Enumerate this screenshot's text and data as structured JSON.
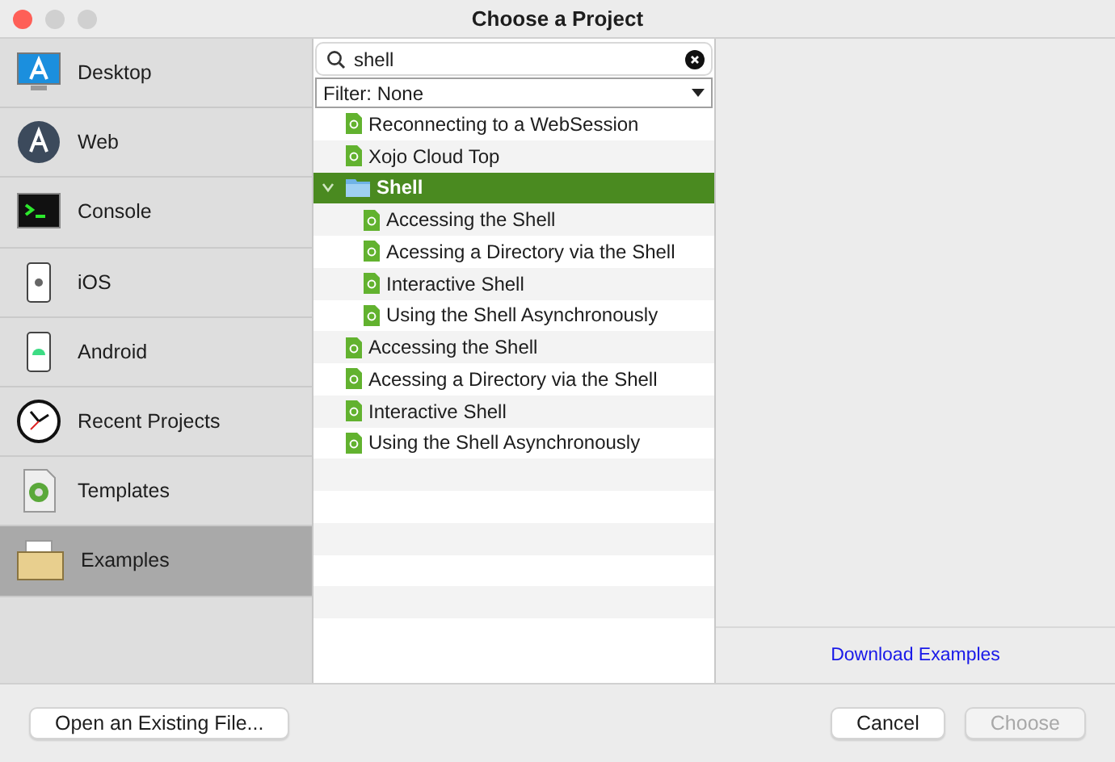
{
  "window": {
    "title": "Choose a Project"
  },
  "sidebar": {
    "items": [
      {
        "label": "Desktop",
        "selected": false
      },
      {
        "label": "Web",
        "selected": false
      },
      {
        "label": "Console",
        "selected": false
      },
      {
        "label": "iOS",
        "selected": false
      },
      {
        "label": "Android",
        "selected": false
      },
      {
        "label": "Recent Projects",
        "selected": false
      },
      {
        "label": "Templates",
        "selected": false
      },
      {
        "label": "Examples",
        "selected": true
      }
    ]
  },
  "search": {
    "value": "shell"
  },
  "filter": {
    "value": "Filter: None"
  },
  "tree": [
    {
      "label": "Reconnecting to a WebSession",
      "kind": "file",
      "selected": false
    },
    {
      "label": "Xojo Cloud Top",
      "kind": "file",
      "selected": false
    },
    {
      "label": "Shell",
      "kind": "folder",
      "selected": true,
      "expanded": true,
      "children": [
        {
          "label": "Accessing the Shell",
          "kind": "file",
          "selected": false
        },
        {
          "label": "Acessing a Directory via the Shell",
          "kind": "file",
          "selected": false
        },
        {
          "label": "Interactive Shell",
          "kind": "file",
          "selected": false
        },
        {
          "label": "Using the Shell Asynchronously",
          "kind": "file",
          "selected": false
        }
      ]
    },
    {
      "label": "Accessing the Shell",
      "kind": "file",
      "selected": false
    },
    {
      "label": "Acessing a Directory via the Shell",
      "kind": "file",
      "selected": false
    },
    {
      "label": "Interactive Shell",
      "kind": "file",
      "selected": false
    },
    {
      "label": "Using the Shell Asynchronously",
      "kind": "file",
      "selected": false
    }
  ],
  "download_link": "Download Examples",
  "buttons": [
    {
      "label": "Open an Existing File...",
      "disabled": false
    },
    {
      "label": "Cancel",
      "disabled": false
    },
    {
      "label": "Choose",
      "disabled": true
    }
  ]
}
